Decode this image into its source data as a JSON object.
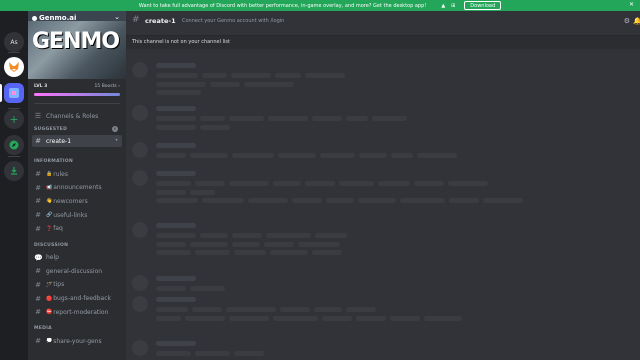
{
  "banner": {
    "text": "Want to take full advantage of Discord with better performance, in-game overlay, and more? Get the desktop app!",
    "download_label": "Download",
    "platforms": [
      "apple-icon",
      "android-icon",
      "windows-icon"
    ]
  },
  "rail": {
    "servers": [
      {
        "label": "As"
      },
      {
        "label": ""
      },
      {
        "label": ""
      },
      {
        "label": "+"
      },
      {
        "label": ""
      },
      {
        "label": ""
      }
    ]
  },
  "server": {
    "name": "Genmo.ai",
    "banner_logo": "GENMO",
    "level_label": "LVL 3",
    "boosts_label": "15 Boosts",
    "boost_progress": 1.0
  },
  "sidebar": {
    "top_items": [
      {
        "label": "Channels & Roles"
      }
    ],
    "suggested_label": "SUGGESTED",
    "suggested_channel": "create-1",
    "categories": [
      {
        "label": "INFORMATION",
        "channels": [
          "rules",
          "announcements",
          "newcomers",
          "useful-links",
          "faq"
        ]
      },
      {
        "label": "DISCUSSION",
        "channels": [
          "help",
          "general-discussion",
          "tips",
          "bugs-and-feedback",
          "report-moderation"
        ]
      },
      {
        "label": "MEDIA",
        "channels": [
          "share-your-gens"
        ]
      }
    ],
    "channel_prefixes": {
      "rules": "🔒",
      "announcements": "📢",
      "newcomers": "👋",
      "useful-links": "🔗",
      "faq": "❓",
      "tips": "🪄",
      "bugs-and-feedback": "🔴",
      "report-moderation": "⛔",
      "share-your-gens": "💭"
    }
  },
  "channel": {
    "name": "create-1",
    "topic": "Connect your Genmo account with /login",
    "notice": "This channel is not on your channel list"
  },
  "colors": {
    "banner_bg": "#23a55a",
    "rail_bg": "#1e1f22",
    "sidebar_bg": "#2b2d31",
    "main_bg": "#313338",
    "active_channel_bg": "#404249"
  }
}
